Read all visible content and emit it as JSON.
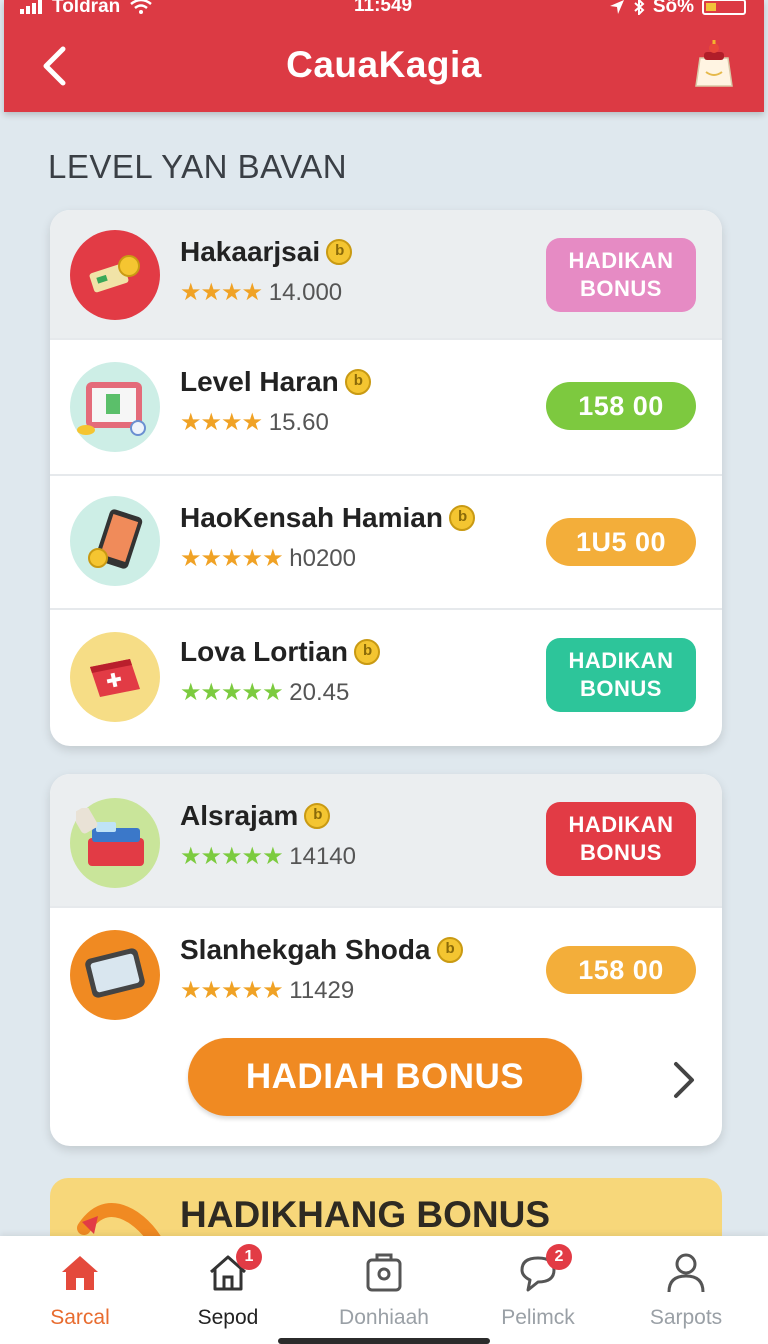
{
  "status_bar": {
    "carrier": "Toldran",
    "time": "11:549",
    "battery": "Sö%"
  },
  "header": {
    "title": "CauaKagia"
  },
  "section_title": "LEVEL YAN BAVAN",
  "card1": {
    "items": [
      {
        "name": "Hakaarjsai",
        "stars": "★★★★",
        "rating": "14.000",
        "action": "HADIKAN BONUS",
        "action_color": "#e68bc4"
      },
      {
        "name": "Level Haran",
        "stars": "★★★★",
        "rating": "15.60",
        "action": "158 00",
        "action_color": "#7dc93f"
      },
      {
        "name": "HaoKensah Hamian",
        "stars": "★★★★★",
        "rating": "h0200",
        "action": "1U5 00",
        "action_color": "#f3ae3a"
      },
      {
        "name": "Lova Lortian",
        "stars": "★★★★★",
        "rating": "20.45",
        "action": "HADIKAN BONUS",
        "action_color": "#2dc59a"
      }
    ]
  },
  "card2": {
    "items": [
      {
        "name": "Alsrajam",
        "stars": "★★★★★",
        "rating": "14140",
        "action": "HADIKAN BONUS",
        "action_color": "#e23b45"
      },
      {
        "name": "Slanhekgah Shoda",
        "stars": "★★★★★",
        "rating": "11429",
        "action": "158 00",
        "action_color": "#f3ae3a"
      }
    ],
    "main_button": "HADIAH BONUS"
  },
  "banner": {
    "text": "HADIKHANG BONUS"
  },
  "bottom_nav": [
    {
      "label": "Sarcal",
      "icon": "home-icon"
    },
    {
      "label": "Sepod",
      "icon": "house-outline-icon",
      "badge": "1"
    },
    {
      "label": "Donhiaah",
      "icon": "bag-icon"
    },
    {
      "label": "Pelimck",
      "icon": "chat-bubble-icon",
      "badge": "2"
    },
    {
      "label": "Sarpots",
      "icon": "profile-icon"
    }
  ],
  "colors": {
    "header": "#dc3a44",
    "accent_orange": "#f08a22",
    "active_nav": "#e86c2f"
  }
}
